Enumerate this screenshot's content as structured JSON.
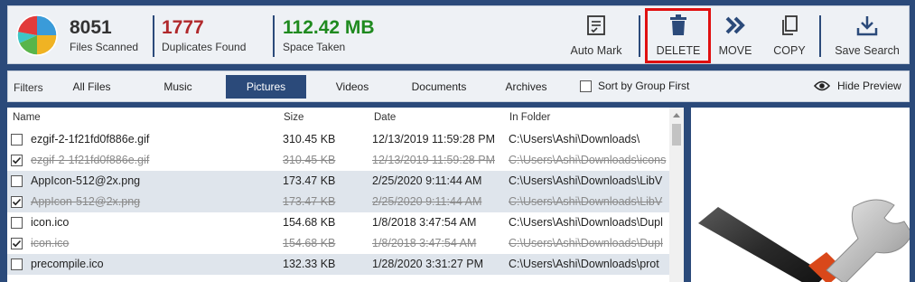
{
  "stats": {
    "files_scanned": {
      "value": "8051",
      "label": "Files Scanned"
    },
    "duplicates_found": {
      "value": "1777",
      "label": "Duplicates Found"
    },
    "space_taken": {
      "value": "112.42 MB",
      "label": "Space Taken"
    }
  },
  "toolbar": {
    "auto_mark": "Auto Mark",
    "delete": "DELETE",
    "move": "MOVE",
    "copy": "COPY",
    "save_search": "Save Search"
  },
  "filters": {
    "label": "Filters",
    "tabs": [
      "All Files",
      "Music",
      "Pictures",
      "Videos",
      "Documents",
      "Archives"
    ],
    "active_tab": "Pictures",
    "sort_by_group": {
      "label": "Sort by Group First",
      "checked": false
    },
    "hide_preview": "Hide Preview"
  },
  "table": {
    "columns": [
      "Name",
      "Size",
      "Date",
      "In Folder"
    ],
    "rows": [
      {
        "name": "ezgif-2-1f21fd0f886e.gif",
        "size": "310.45 KB",
        "date": "12/13/2019 11:59:28 PM",
        "folder": "C:\\Users\\Ashi\\Downloads\\",
        "checked": false
      },
      {
        "name": "ezgif-2-1f21fd0f886e.gif",
        "size": "310.45 KB",
        "date": "12/13/2019 11:59:28 PM",
        "folder": "C:\\Users\\Ashi\\Downloads\\icons",
        "checked": true
      },
      {
        "name": "AppIcon-512@2x.png",
        "size": "173.47 KB",
        "date": "2/25/2020 9:11:44 AM",
        "folder": "C:\\Users\\Ashi\\Downloads\\LibV",
        "checked": false
      },
      {
        "name": "AppIcon-512@2x.png",
        "size": "173.47 KB",
        "date": "2/25/2020 9:11:44 AM",
        "folder": "C:\\Users\\Ashi\\Downloads\\LibV",
        "checked": true
      },
      {
        "name": "icon.ico",
        "size": "154.68 KB",
        "date": "1/8/2018 3:47:54 AM",
        "folder": "C:\\Users\\Ashi\\Downloads\\Dupl",
        "checked": false
      },
      {
        "name": "icon.ico",
        "size": "154.68 KB",
        "date": "1/8/2018 3:47:54 AM",
        "folder": "C:\\Users\\Ashi\\Downloads\\Dupl",
        "checked": true
      },
      {
        "name": "precompile.ico",
        "size": "132.33 KB",
        "date": "1/28/2020 3:31:27 PM",
        "folder": "C:\\Users\\Ashi\\Downloads\\prot",
        "checked": false
      }
    ]
  },
  "colors": {
    "frame": "#2b4a7a",
    "duplicates": "#b0282b",
    "space": "#1f8a1f",
    "delete_highlight": "#e01010"
  },
  "icons": [
    "app-logo-pie-icon",
    "auto-mark-icon",
    "trash-icon",
    "double-chevron-right-icon",
    "copy-icon",
    "download-icon",
    "eye-icon",
    "wrench-preview-icon"
  ]
}
